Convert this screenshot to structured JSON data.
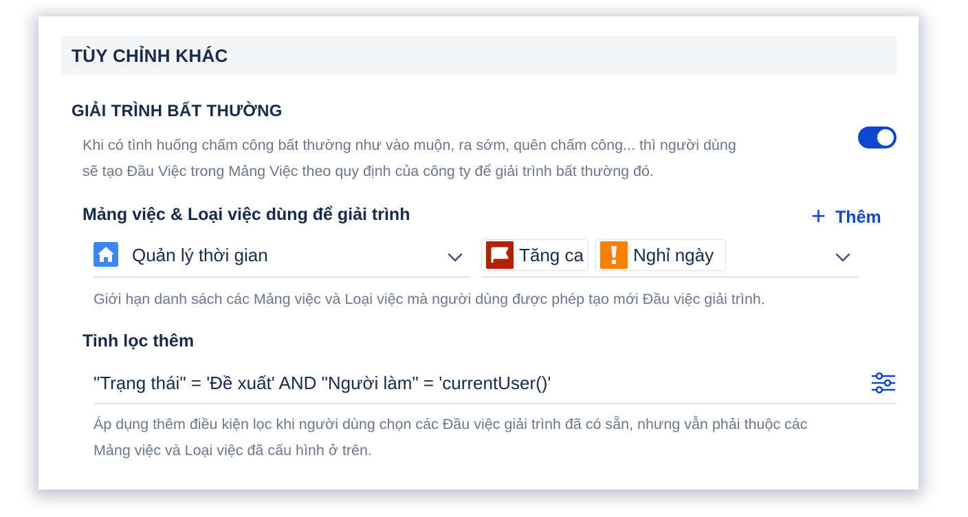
{
  "section": {
    "title": "TÙY CHỈNH KHÁC"
  },
  "anomaly": {
    "title": "GIẢI TRÌNH BẤT THƯỜNG",
    "description_line1": "Khi có tình huống chấm công bất thường như vào muộn, ra sớm, quên chấm công... thì người dùng",
    "description_line2": "sẽ tạo Đầu Việc trong Mảng Việc theo quy định của công ty để giải trình bất thường đó.",
    "toggle_on": true,
    "accent_color": "#0c47d0"
  },
  "projects": {
    "label": "Mảng việc & Loại việc dùng để giải trình",
    "add_label": "Thêm",
    "project_name": "Quản lý thời gian",
    "project_icon": "house-icon",
    "issue_types": [
      {
        "label": "Tăng ca",
        "icon": "flag-icon",
        "color": "#b32200"
      },
      {
        "label": "Nghỉ ngày",
        "icon": "exclamation-icon",
        "color": "#ff8000"
      }
    ],
    "hint": "Giới hạn danh sách các Mảng việc và Loại việc mà người dùng được phép tạo mới Đầu việc giải trình."
  },
  "filter": {
    "label": "Tinh lọc thêm",
    "value": "\"Trạng thái\" = 'Đề xuất' AND \"Người làm\" = 'currentUser()'",
    "description_line1": "Áp dụng thêm điều kiện lọc khi người dùng chọn các Đầu việc giải trình đã có sẵn, nhưng vẫn phải thuộc các",
    "description_line2": "Mảng việc và Loại việc đã cấu hình ở trên."
  }
}
